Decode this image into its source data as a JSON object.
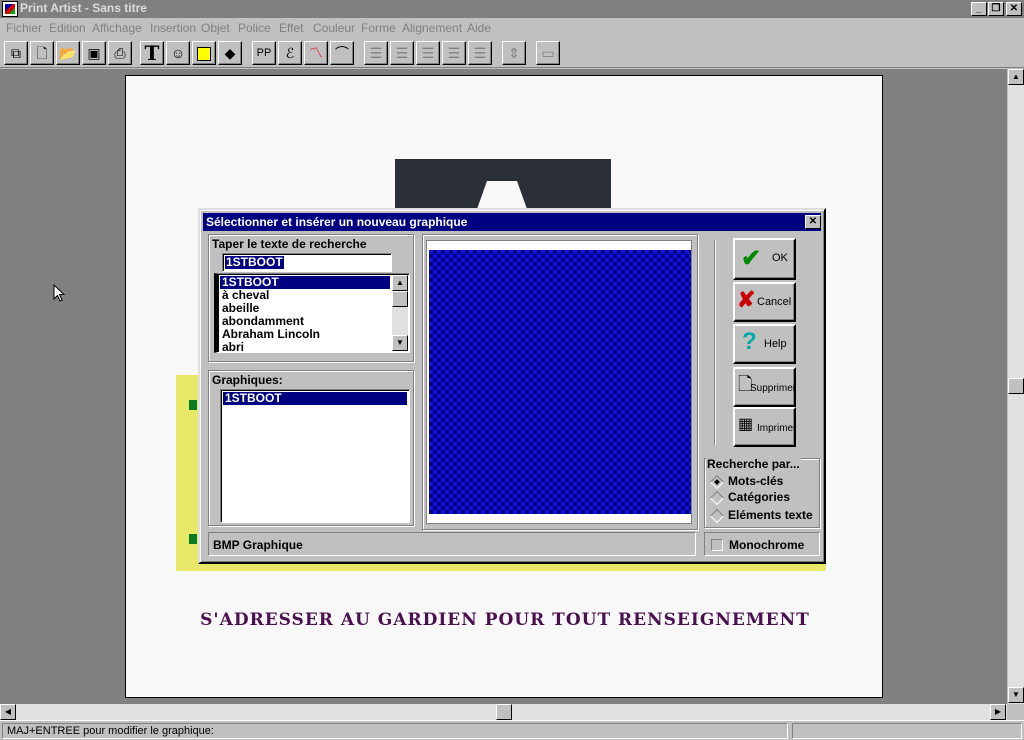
{
  "window": {
    "title": "Print Artist - Sans titre"
  },
  "menu": [
    "Fichier",
    "Edition",
    "Affichage",
    "Insertion",
    "Objet",
    "Police",
    "Effet",
    "Couleur",
    "Forme",
    "Alignement",
    "Aide"
  ],
  "toolbar": {
    "text_tool": "T",
    "icons": [
      "copy-icon",
      "new-document-icon",
      "open-folder-icon",
      "save-icon",
      "print-icon",
      "text-icon",
      "clipart-face-icon",
      "rectangle-icon",
      "shapes-icon",
      "headline-icon",
      "ornament-icon",
      "chart-icon",
      "text-arc-icon",
      "align-left-icon",
      "align-center-icon",
      "align-right-icon",
      "justify-icon",
      "justify-spread-icon",
      "vertical-spacing-icon",
      "frame-icon"
    ]
  },
  "document": {
    "banner_text": "S'ADRESSER AU GARDIEN POUR TOUT RENSEIGNEMENT"
  },
  "dialog": {
    "title": "Sélectionner et insérer un nouveau graphique",
    "search_label": "Taper le texte de recherche",
    "search_value": "1STBOOT",
    "keywords": [
      "1STBOOT",
      "à cheval",
      "abeille",
      "abondamment",
      "Abraham Lincoln",
      "abri"
    ],
    "graphics_label": "Graphiques:",
    "graphics": [
      "1STBOOT"
    ],
    "file_type": "BMP Graphique",
    "buttons": {
      "ok": "OK",
      "cancel": "Cancel",
      "help": "Help",
      "delete": "Supprimer",
      "print": "Imprimer"
    },
    "search_by": {
      "label": "Recherche par...",
      "options": [
        "Mots-clés",
        "Catégories",
        "Eléments texte"
      ],
      "selected": "Mots-clés"
    },
    "monochrome_label": "Monochrome",
    "monochrome_checked": false,
    "colors": {
      "title_bar": "#000080",
      "preview": "#1010e0",
      "selection": "#000080"
    }
  },
  "status": {
    "message": "MAJ+ENTREE pour modifier le graphique:"
  }
}
